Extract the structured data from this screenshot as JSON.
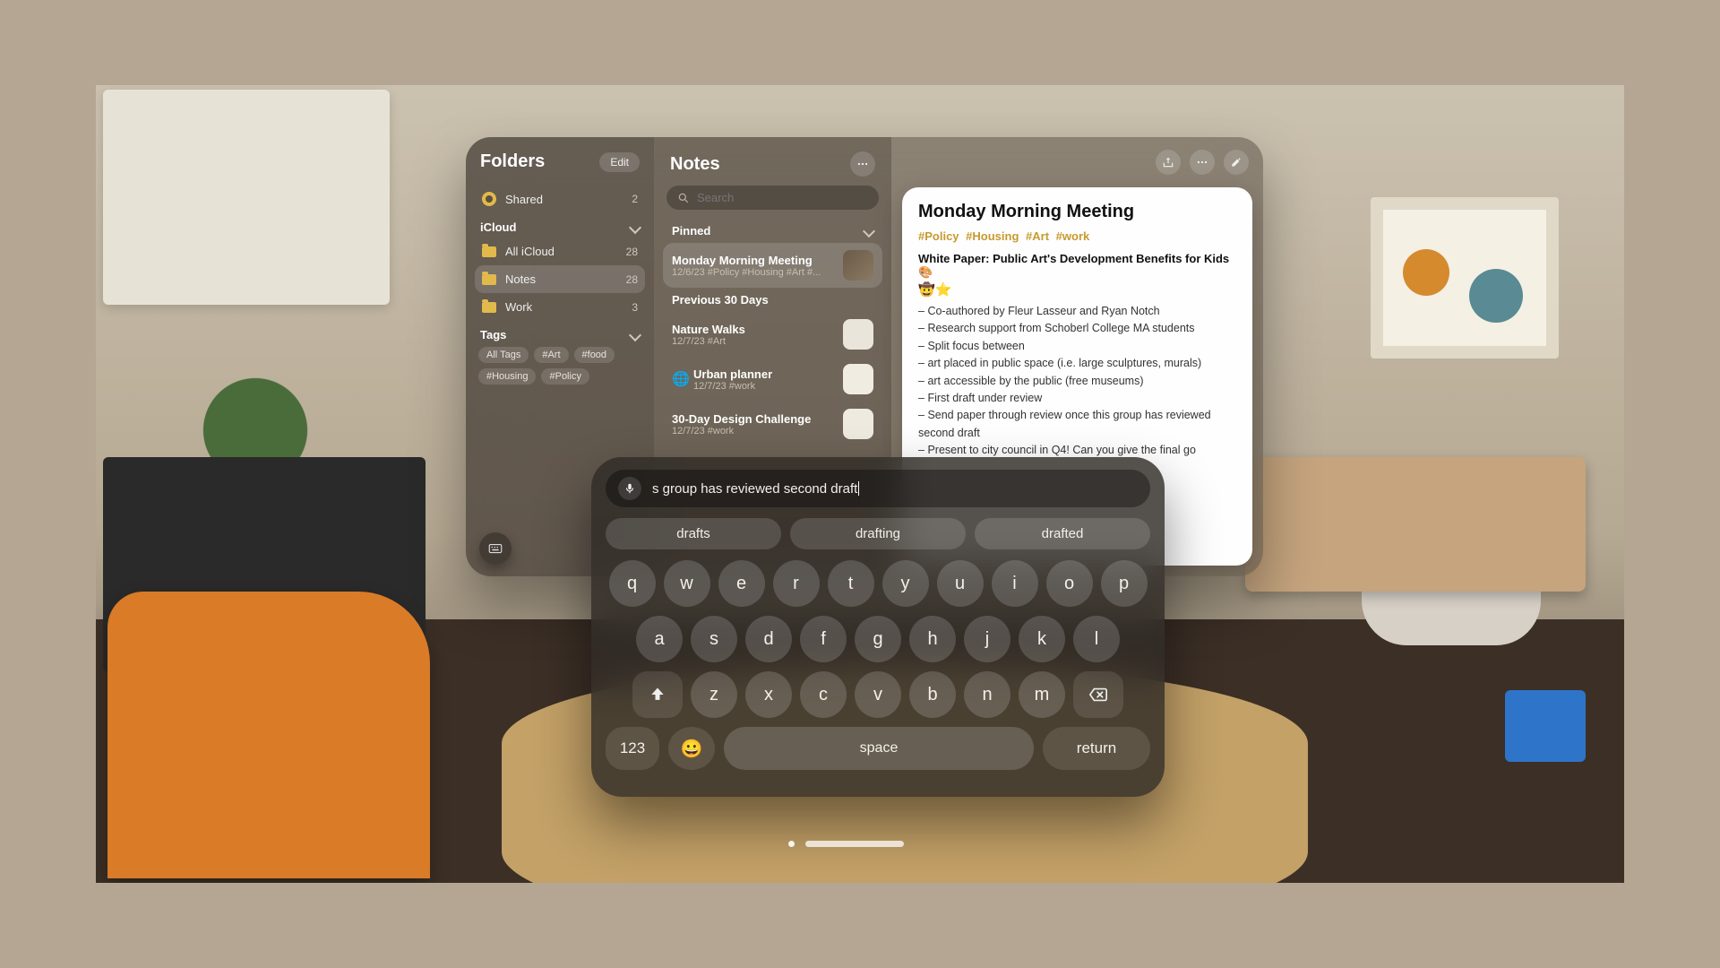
{
  "sidebar": {
    "title": "Folders",
    "edit": "Edit",
    "shared": {
      "label": "Shared",
      "count": "2"
    },
    "icloud_header": "iCloud",
    "tags_header": "Tags",
    "folders": [
      {
        "label": "All iCloud",
        "count": "28"
      },
      {
        "label": "Notes",
        "count": "28"
      },
      {
        "label": "Work",
        "count": "3"
      }
    ],
    "tags": [
      "All Tags",
      "#Art",
      "#food",
      "#Housing",
      "#Policy"
    ]
  },
  "noteslist": {
    "title": "Notes",
    "search_placeholder": "Search",
    "sections": {
      "pinned": "Pinned",
      "prev30": "Previous 30 Days"
    },
    "items": [
      {
        "title": "Monday Morning Meeting",
        "sub": "12/6/23  #Policy #Housing #Art #..."
      },
      {
        "title": "Nature Walks",
        "sub": "12/7/23  #Art"
      },
      {
        "title": "Urban planner",
        "sub": "12/7/23  #work"
      },
      {
        "title": "30-Day Design Challenge",
        "sub": "12/7/23  #work"
      }
    ]
  },
  "note": {
    "title": "Monday Morning Meeting",
    "hashtags": [
      "#Policy",
      "#Housing",
      "#Art",
      "#work"
    ],
    "wp_title": "White Paper: Public Art's Development Benefits for Kids 🎨",
    "emojis": "🤠⭐",
    "bullets": [
      "Co-authored by Fleur Lasseur and Ryan Notch",
      "Research support from Schoberl College MA students",
      "Split focus between",
      "art placed in public space (i.e. large sculptures, murals)",
      "art accessible by the public (free museums)",
      "First draft under review",
      "Send paper through review once this group has reviewed second draft",
      "Present to city council in Q4! Can you give the final go"
    ]
  },
  "keyboard": {
    "input_text": "s group has reviewed second draft",
    "suggestions": [
      "drafts",
      "drafting",
      "drafted"
    ],
    "rows": {
      "r1": [
        "q",
        "w",
        "e",
        "r",
        "t",
        "y",
        "u",
        "i",
        "o",
        "p"
      ],
      "r2": [
        "a",
        "s",
        "d",
        "f",
        "g",
        "h",
        "j",
        "k",
        "l"
      ],
      "r3": [
        "z",
        "x",
        "c",
        "v",
        "b",
        "n",
        "m"
      ]
    },
    "numkey": "123",
    "space": "space",
    "return": "return"
  }
}
